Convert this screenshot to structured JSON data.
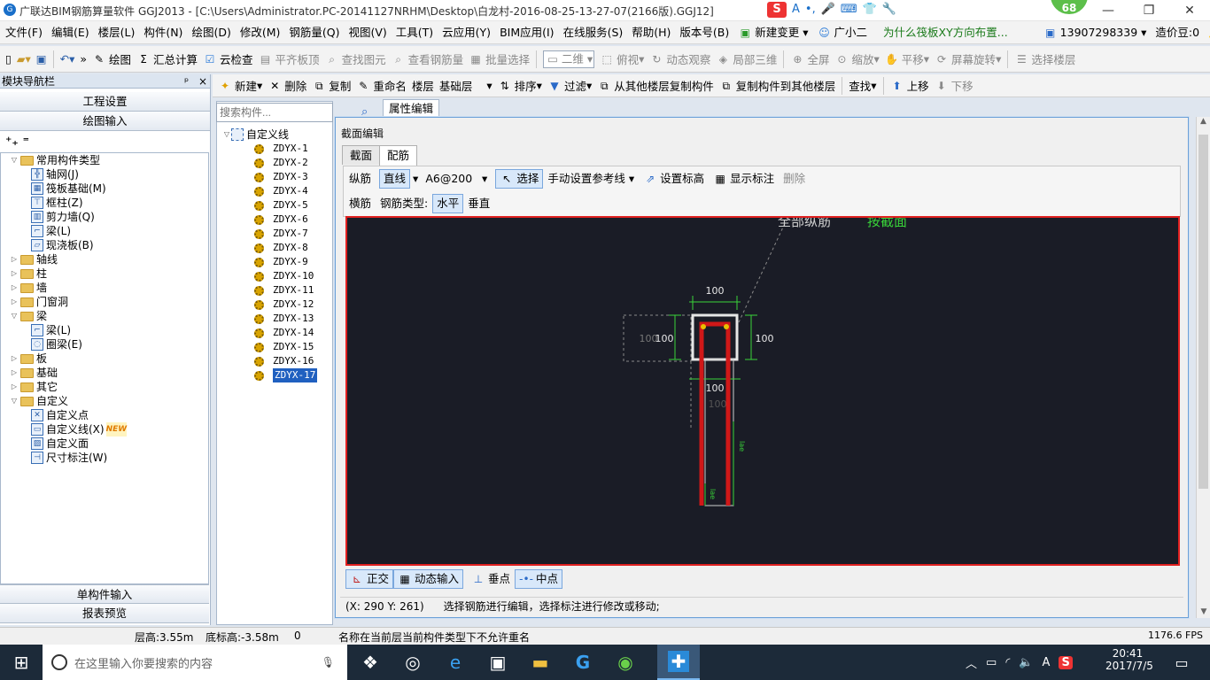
{
  "window": {
    "title": "广联达BIM钢筋算量软件 GGJ2013 - [C:\\Users\\Administrator.PC-20141127NRHM\\Desktop\\白龙村-2016-08-25-13-27-07(2166版).GGJ12]",
    "badge": "68"
  },
  "ime": [
    "S",
    "A",
    "•,",
    "🎤",
    "⌨",
    "👕",
    "🔧"
  ],
  "menu": [
    "文件(F)",
    "编辑(E)",
    "楼层(L)",
    "构件(N)",
    "绘图(D)",
    "修改(M)",
    "钢筋量(Q)",
    "视图(V)",
    "工具(T)",
    "云应用(Y)",
    "BIM应用(I)",
    "在线服务(S)",
    "帮助(H)",
    "版本号(B)",
    "新建变更",
    "广小二",
    "为什么筏板XY方向布置...",
    "13907298339",
    "造价豆:0"
  ],
  "toolbar1": {
    "draw": "绘图",
    "sum": "汇总计算",
    "cloudcheck": "云检查",
    "flatslab": "平齐板顶",
    "findelem": "查找图元",
    "viewrebar": "查看钢筋量",
    "batchsel": "批量选择",
    "mode2d": "二维",
    "topview": "俯视",
    "dynobs": "动态观察",
    "local3d": "局部三维",
    "fullscreen": "全屏",
    "zoom": "缩放",
    "pan": "平移",
    "rotate": "屏幕旋转",
    "selfloor": "选择楼层"
  },
  "nav": {
    "title": "模块导航栏",
    "pin": "ᵖ",
    "close": "×",
    "btn_project": "工程设置",
    "btn_drawing": "绘图输入",
    "btn_single": "单构件输入",
    "btn_report": "报表预览",
    "tree": [
      {
        "label": "常用构件类型",
        "level": 0,
        "folder": true,
        "open": true
      },
      {
        "label": "轴网(J)",
        "level": 1,
        "icon": "grid"
      },
      {
        "label": "筏板基础(M)",
        "level": 1,
        "icon": "raft"
      },
      {
        "label": "框柱(Z)",
        "level": 1,
        "icon": "col"
      },
      {
        "label": "剪力墙(Q)",
        "level": 1,
        "icon": "wall"
      },
      {
        "label": "梁(L)",
        "level": 1,
        "icon": "beam"
      },
      {
        "label": "现浇板(B)",
        "level": 1,
        "icon": "slab"
      },
      {
        "label": "轴线",
        "level": 0,
        "folder": true
      },
      {
        "label": "柱",
        "level": 0,
        "folder": true
      },
      {
        "label": "墙",
        "level": 0,
        "folder": true
      },
      {
        "label": "门窗洞",
        "level": 0,
        "folder": true
      },
      {
        "label": "梁",
        "level": 0,
        "folder": true,
        "open": true
      },
      {
        "label": "梁(L)",
        "level": 1,
        "icon": "beam"
      },
      {
        "label": "圈梁(E)",
        "level": 1,
        "icon": "ring"
      },
      {
        "label": "板",
        "level": 0,
        "folder": true
      },
      {
        "label": "基础",
        "level": 0,
        "folder": true
      },
      {
        "label": "其它",
        "level": 0,
        "folder": true
      },
      {
        "label": "自定义",
        "level": 0,
        "folder": true,
        "open": true
      },
      {
        "label": "自定义点",
        "level": 1,
        "icon": "pt"
      },
      {
        "label": "自定义线(X)",
        "level": 1,
        "icon": "line",
        "new": "NEW"
      },
      {
        "label": "自定义面",
        "level": 1,
        "icon": "face"
      },
      {
        "label": "尺寸标注(W)",
        "level": 1,
        "icon": "dim"
      }
    ]
  },
  "toolbar2": [
    "新建",
    "删除",
    "复制",
    "重命名",
    "楼层",
    "基础层",
    "排序",
    "过滤",
    "从其他楼层复制构件",
    "复制构件到其他楼层",
    "查找",
    "上移",
    "下移"
  ],
  "search_placeholder": "搜索构件...",
  "comptree": {
    "root": "自定义线",
    "items": [
      "ZDYX-1",
      "ZDYX-2",
      "ZDYX-3",
      "ZDYX-4",
      "ZDYX-5",
      "ZDYX-6",
      "ZDYX-7",
      "ZDYX-8",
      "ZDYX-9",
      "ZDYX-10",
      "ZDYX-11",
      "ZDYX-12",
      "ZDYX-13",
      "ZDYX-14",
      "ZDYX-15",
      "ZDYX-16",
      "ZDYX-17"
    ],
    "selected": "ZDYX-17"
  },
  "proptab": "属性编辑",
  "dialog": {
    "title": "截面编辑",
    "tabs": [
      "截面",
      "配筋"
    ],
    "active_tab": "配筋",
    "row1": {
      "long": "纵筋",
      "straight": "直线",
      "spec": "A6@200",
      "select": "选择",
      "manualref": "手动设置参考线",
      "setelev": "设置标高",
      "showdim": "显示标注",
      "delete": "删除"
    },
    "row2": {
      "trans": "横筋",
      "typelabel": "钢筋类型:",
      "horiz": "水平",
      "vert": "垂直"
    },
    "canvas": {
      "note_white": "全部纵筋",
      "note_green": "按截面",
      "dims": [
        "100",
        "100",
        "100",
        "100",
        "100",
        "100"
      ],
      "lae": "lae",
      "bg_color": "#1a1c26",
      "rebar_color": "#d01818",
      "dim_color": "#39d339"
    },
    "bottom": {
      "ortho": "正交",
      "dyninput": "动态输入",
      "perp": "垂点",
      "mid": "中点"
    },
    "coords": "(X: 290 Y: 261)",
    "hint": "选择钢筋进行编辑，选择标注进行修改或移动;"
  },
  "statusbar": {
    "floorh": "层高:3.55m",
    "bottomh": "底标高:-3.58m",
    "zero": "0",
    "msg": "名称在当前层当前构件类型下不允许重名",
    "fps": "1176.6 FPS"
  },
  "taskbar": {
    "search": "在这里输入你要搜索的内容",
    "time": "20:41",
    "date": "2017/7/5",
    "lang": "A"
  }
}
